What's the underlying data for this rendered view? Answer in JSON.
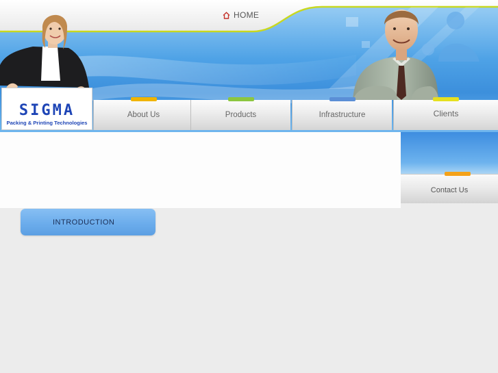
{
  "header": {
    "home_label": "HOME"
  },
  "logo": {
    "title": "SIGMA",
    "subtitle": "Packing & Printing Technologies"
  },
  "nav": {
    "items": [
      {
        "label": "About Us",
        "tab_color": "#f0b400"
      },
      {
        "label": "Products",
        "tab_color": "#8cc63f"
      },
      {
        "label": "Infrastructure",
        "tab_color": "#5b8fd6"
      },
      {
        "label": "Clients",
        "tab_color": "#e6e020"
      }
    ]
  },
  "side": {
    "contact_label": "Contact Us",
    "contact_tab_color": "#f4a21a"
  },
  "content": {
    "section_title": "INTRODUCTION"
  },
  "colors": {
    "brand_blue": "#1e45b6",
    "banner_blue": "#3c8fdc",
    "accent_line": "#c8d820"
  }
}
